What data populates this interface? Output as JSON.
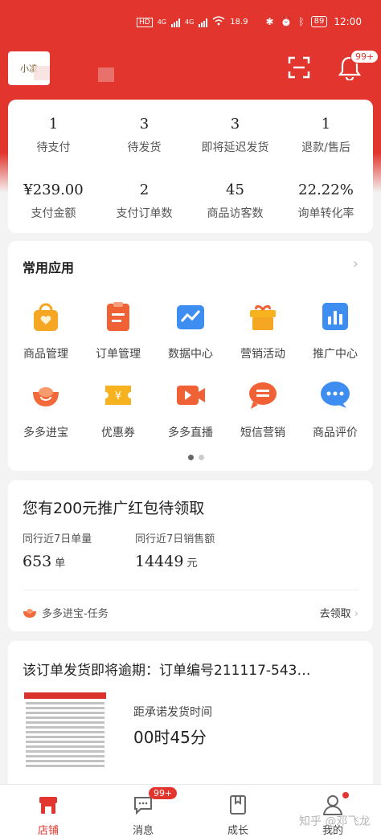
{
  "status_bar": {
    "left": [
      "HD",
      "4G",
      "4G",
      "18.9"
    ],
    "battery": "89",
    "time": "12:00"
  },
  "header": {
    "logo_text": "小凌",
    "notification_badge": "99+",
    "icons": [
      "scan-icon",
      "bell-icon"
    ]
  },
  "stats": [
    {
      "value": "1",
      "label": "待支付"
    },
    {
      "value": "3",
      "label": "待发货"
    },
    {
      "value": "3",
      "label": "即将延迟发货"
    },
    {
      "value": "1",
      "label": "退款/售后"
    },
    {
      "value": "¥239.00",
      "label": "支付金额"
    },
    {
      "value": "2",
      "label": "支付订单数"
    },
    {
      "value": "45",
      "label": "商品访客数"
    },
    {
      "value": "22.22%",
      "label": "询单转化率"
    }
  ],
  "apps": {
    "title": "常用应用",
    "items": [
      {
        "label": "商品管理",
        "icon": "shopping-bag-icon",
        "color": "#f5a623"
      },
      {
        "label": "订单管理",
        "icon": "order-list-icon",
        "color": "#f06235"
      },
      {
        "label": "数据中心",
        "icon": "chart-line-icon",
        "color": "#3d8ef0"
      },
      {
        "label": "营销活动",
        "icon": "gift-icon",
        "color": "#f7b31f"
      },
      {
        "label": "推广中心",
        "icon": "bar-chart-icon",
        "color": "#3d8ef0"
      },
      {
        "label": "多多进宝",
        "icon": "ingot-icon",
        "color": "#f26a3a"
      },
      {
        "label": "优惠券",
        "icon": "coupon-icon",
        "color": "#f7b31f"
      },
      {
        "label": "多多直播",
        "icon": "video-icon",
        "color": "#f06235"
      },
      {
        "label": "短信营销",
        "icon": "message-icon",
        "color": "#f06235"
      },
      {
        "label": "商品评价",
        "icon": "comment-icon",
        "color": "#3d8ef0"
      }
    ]
  },
  "promo": {
    "title": "您有200元推广红包待领取",
    "col1_label": "同行近7日单量",
    "col1_value": "653",
    "col1_unit": "单",
    "col2_label": "同行近7日销售额",
    "col2_value": "14449",
    "col2_unit": "元",
    "task": "多多进宝-任务",
    "action": "去领取"
  },
  "order": {
    "title": "该订单发货即将逾期：订单编号211117-543…",
    "deadline_label": "距承诺发货时间",
    "deadline_value": "00时45分"
  },
  "tabbar": {
    "items": [
      {
        "label": "店铺",
        "icon": "store-icon"
      },
      {
        "label": "消息",
        "icon": "chat-icon"
      },
      {
        "label": "成长",
        "icon": "book-icon"
      },
      {
        "label": "我的",
        "icon": "user-icon"
      }
    ],
    "message_badge": "99+"
  },
  "watermark": "知乎 @邓飞龙",
  "colors": {
    "brand": "#e2352d"
  }
}
